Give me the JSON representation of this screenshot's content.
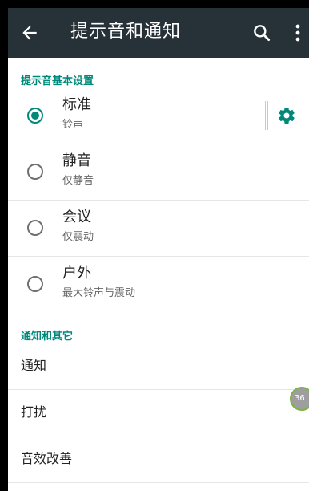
{
  "toolbar": {
    "title": "提示音和通知",
    "back_icon": "arrow-back-icon",
    "search_icon": "search-icon",
    "more_icon": "more-vert-icon"
  },
  "sections": {
    "basic_header": "提示音基本设置",
    "other_header": "通知和其它"
  },
  "profiles": [
    {
      "label": "标准",
      "sub": "铃声",
      "checked": true
    },
    {
      "label": "静音",
      "sub": "仅静音",
      "checked": false
    },
    {
      "label": "会议",
      "sub": "仅震动",
      "checked": false
    },
    {
      "label": "户外",
      "sub": "最大铃声与震动",
      "checked": false
    }
  ],
  "other_items": [
    {
      "label": "通知"
    },
    {
      "label": "打扰"
    },
    {
      "label": "音效改善"
    }
  ],
  "floating_ball": {
    "text": "36"
  },
  "colors": {
    "toolbar_bg": "#263238",
    "accent": "#00897b"
  }
}
